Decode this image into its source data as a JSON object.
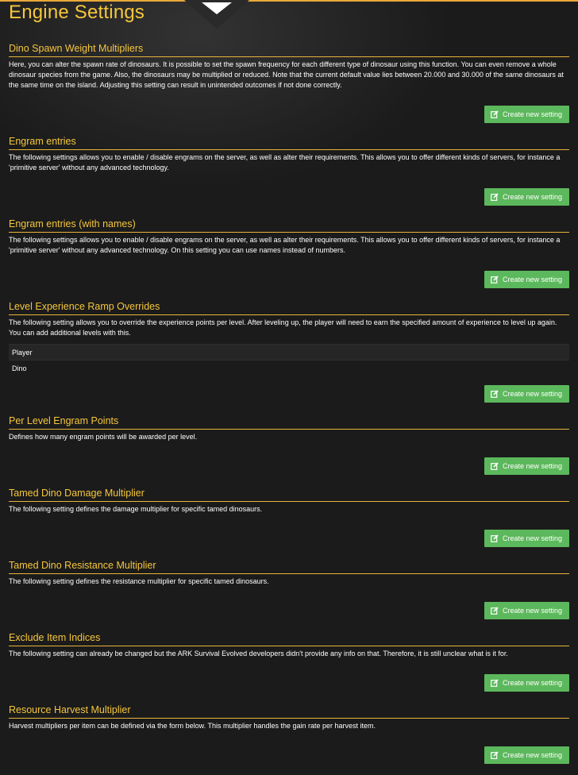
{
  "page": {
    "title": "Engine Settings"
  },
  "button_label": "Create new setting",
  "colors": {
    "accent": "#f6c63c",
    "button": "#5cb85c",
    "background": "#1b1b1b"
  },
  "sections": [
    {
      "title": "Dino Spawn Weight Multipliers",
      "description": "Here, you can alter the spawn rate of dinosaurs. It is possible to set the spawn frequency for each different type of dinosaur using this function. You can even remove a whole dinosaur species from the game. Also, the dinosaurs may be multiplied or reduced. Note that the current default value lies between 20.000 and 30.000 of the same dinosaurs at the same time on the island. Adjusting this setting can result in unintended outcomes if not done correctly."
    },
    {
      "title": "Engram entries",
      "description": "The following settings allows you to enable / disable engrams on the server, as well as alter their requirements. This allows you to offer different kinds of servers, for instance a 'primitive server' without any advanced technology."
    },
    {
      "title": "Engram entries (with names)",
      "description": "The following settings allows you to enable / disable engrams on the server, as well as alter their requirements. This allows you to offer different kinds of servers, for instance a 'primitive server' without any advanced technology. On this setting you can use names instead of numbers."
    },
    {
      "title": "Level Experience Ramp Overrides",
      "description": "The following setting allows you to override the experience points per level. After leveling up, the player will need to earn the specified amount of experience to level up again. You can add additional levels with this.",
      "rows": [
        "Player",
        "Dino"
      ]
    },
    {
      "title": "Per Level Engram Points",
      "description": "Defines how many engram points will be awarded per level."
    },
    {
      "title": "Tamed Dino Damage Multiplier",
      "description": "The following setting defines the damage multiplier for specific tamed dinosaurs."
    },
    {
      "title": "Tamed Dino Resistance Multiplier",
      "description": "The following setting defines the resistance multiplier for specific tamed dinosaurs."
    },
    {
      "title": "Exclude Item Indices",
      "description": "The following setting can already be changed but the ARK Survival Evolved developers didn't provide any info on that. Therefore, it is still unclear what is it for."
    },
    {
      "title": "Resource Harvest Multiplier",
      "description": "Harvest multipliers per item can be defined via the form below. This multiplier handles the gain rate per harvest item."
    }
  ]
}
